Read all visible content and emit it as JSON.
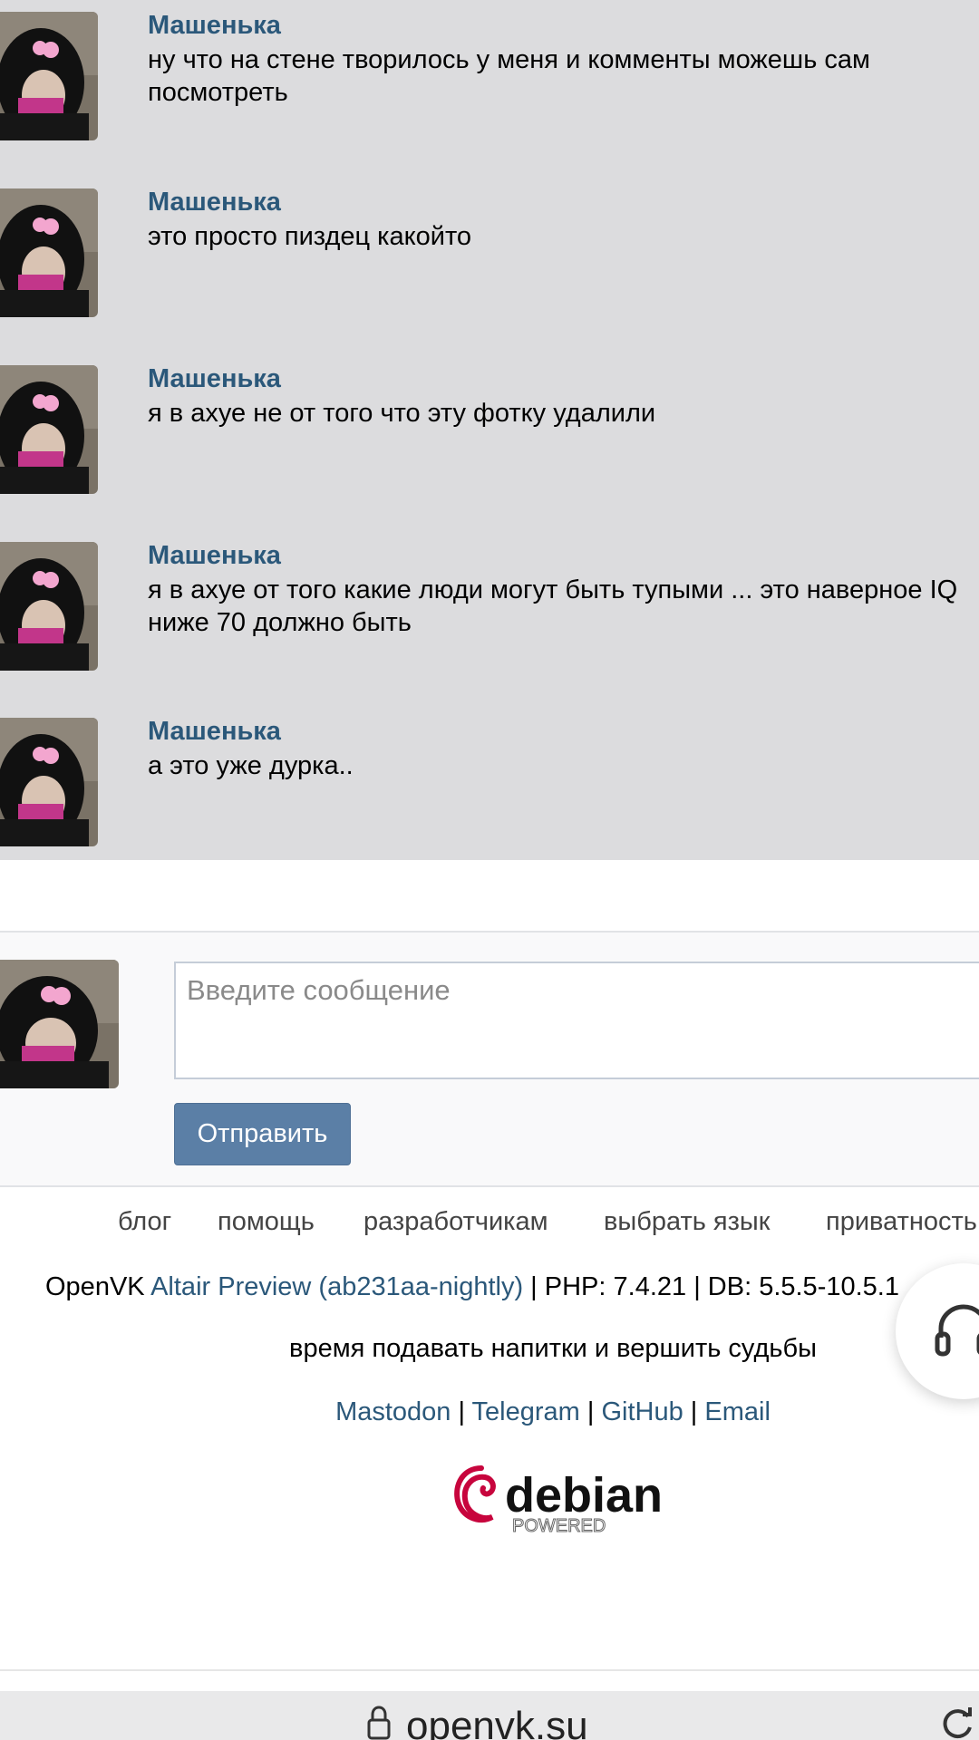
{
  "messages": [
    {
      "author": "Машенька",
      "text": "ну что на стене творилось у меня и комменты можешь сам посмотреть"
    },
    {
      "author": "Машенька",
      "text": "это просто пиздец какойто"
    },
    {
      "author": "Машенька",
      "text": "я в ахуе не от того что эту фотку удалили"
    },
    {
      "author": "Машенька",
      "text": "я в ахуе от того какие люди могут быть тупыми ... это наверное IQ ниже 70 должно быть"
    },
    {
      "author": "Машенька",
      "text": "а это уже дурка.."
    }
  ],
  "compose": {
    "placeholder": "Введите сообщение",
    "send_label": "Отправить"
  },
  "footer": {
    "links": [
      "блог",
      "помощь",
      "разработчикам",
      "выбрать язык",
      "приватность"
    ],
    "version_prefix": "OpenVK ",
    "version_link": "Altair Preview (ab231aa-nightly)",
    "version_suffix": " | PHP: 7.4.21 | DB: 5.5.5-10.5.1",
    "tagline": "время подавать напитки и вершить судьбы",
    "social": [
      "Mastodon",
      "Telegram",
      "GitHub",
      "Email"
    ],
    "social_separator": " | ",
    "logo_text": "debian",
    "logo_subtext": "POWERED"
  },
  "browser": {
    "url": "openvk.su"
  },
  "colors": {
    "link": "#2b587a",
    "message_bg": "#dcdcde",
    "button": "#5b7fa6"
  }
}
